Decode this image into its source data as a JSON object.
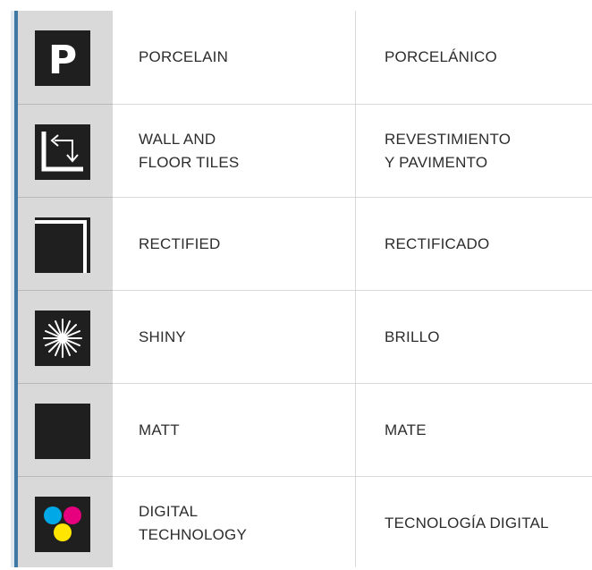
{
  "rows": [
    {
      "icon": "porcelain-p-icon",
      "en": "PORCELAIN",
      "es": "PORCELÁNICO"
    },
    {
      "icon": "wall-floor-tiles-icon",
      "en": "WALL AND\nFLOOR TILES",
      "es": "REVESTIMIENTO\nY PAVIMENTO"
    },
    {
      "icon": "rectified-corner-icon",
      "en": "RECTIFIED",
      "es": "RECTIFICADO"
    },
    {
      "icon": "shiny-star-icon",
      "en": "SHINY",
      "es": "BRILLO"
    },
    {
      "icon": "matt-square-icon",
      "en": "MATT",
      "es": "MATE"
    },
    {
      "icon": "digital-technology-cmy-icon",
      "en": "DIGITAL\nTECHNOLOGY",
      "es": "TECNOLOGÍA DIGITAL"
    }
  ],
  "icons": {
    "porcelain_letter": "P"
  },
  "colors": {
    "accent_blue": "#3f78a3",
    "icon_column": "#d9d9d9",
    "icon_bg": "#1f1f1f",
    "text": "#2d2d2d",
    "cyan": "#00a8e8",
    "magenta": "#e6007e",
    "yellow": "#ffe500"
  }
}
